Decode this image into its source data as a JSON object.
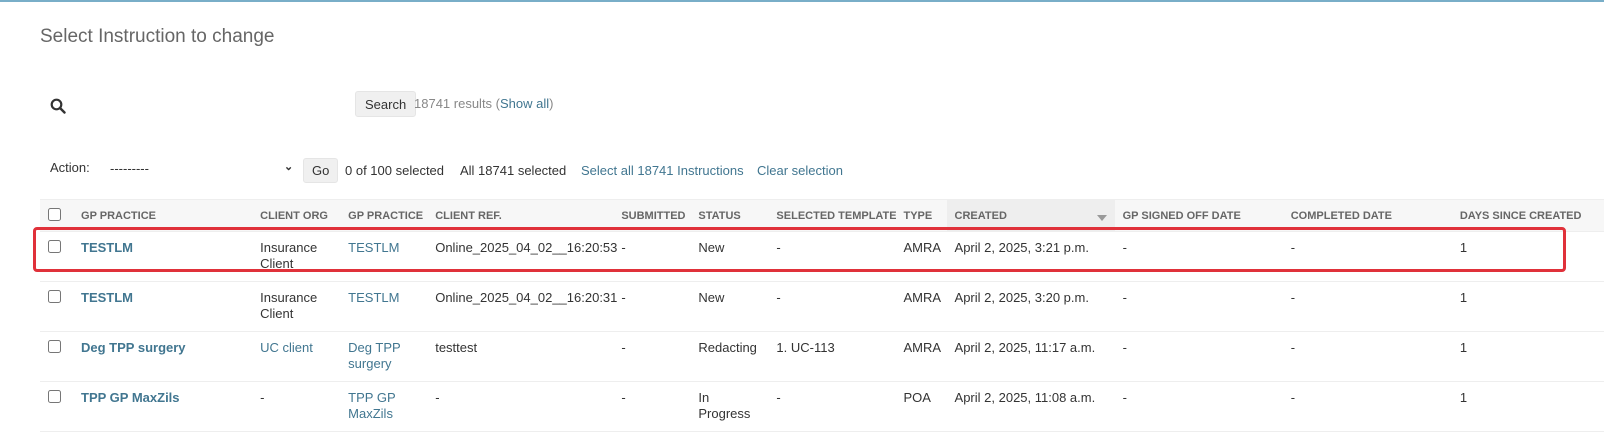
{
  "page": {
    "title": "Select Instruction to change"
  },
  "search": {
    "placeholder": "",
    "button_label": "Search",
    "results_text": "18741 results (",
    "show_all_label": "Show all",
    "results_close": ")"
  },
  "actions": {
    "label": "Action:",
    "selected_option": "---------",
    "go_label": "Go",
    "counter": "0 of 100 selected",
    "all_selected": "All 18741 selected",
    "select_all_link": "Select all 18741 Instructions",
    "clear_selection_link": "Clear selection"
  },
  "table": {
    "columns": [
      "GP PRACTICE",
      "CLIENT ORG",
      "GP PRACTICE",
      "CLIENT REF.",
      "SUBMITTED",
      "STATUS",
      "SELECTED TEMPLATE",
      "TYPE",
      "CREATED",
      "GP SIGNED OFF DATE",
      "COMPLETED DATE",
      "DAYS SINCE CREATED"
    ],
    "sorted_column": "CREATED",
    "rows": [
      {
        "gp_practice": "TESTLM",
        "client_org": "Insurance Client",
        "gp_practice_2": "TESTLM",
        "client_ref": "Online_2025_04_02__16:20:53",
        "submitted": "-",
        "status": "New",
        "template": "-",
        "type": "AMRA",
        "created": "April 2, 2025, 3:21 p.m.",
        "gp_signed_off": "-",
        "completed": "-",
        "days": "1"
      },
      {
        "gp_practice": "TESTLM",
        "client_org": "Insurance Client",
        "gp_practice_2": "TESTLM",
        "client_ref": "Online_2025_04_02__16:20:31",
        "submitted": "-",
        "status": "New",
        "template": "-",
        "type": "AMRA",
        "created": "April 2, 2025, 3:20 p.m.",
        "gp_signed_off": "-",
        "completed": "-",
        "days": "1"
      },
      {
        "gp_practice": "Deg TPP surgery",
        "client_org": "UC client",
        "gp_practice_2": "Deg TPP surgery",
        "client_ref": "testtest",
        "submitted": "-",
        "status": "Redacting",
        "template": "1. UC-113",
        "type": "AMRA",
        "created": "April 2, 2025, 11:17 a.m.",
        "gp_signed_off": "-",
        "completed": "-",
        "days": "1"
      },
      {
        "gp_practice": "TPP GP MaxZils",
        "client_org": "-",
        "gp_practice_2": "TPP GP MaxZils",
        "client_ref": "-",
        "submitted": "-",
        "status": "In Progress",
        "template": "-",
        "type": "POA",
        "created": "April 2, 2025, 11:08 a.m.",
        "gp_signed_off": "-",
        "completed": "-",
        "days": "1"
      }
    ]
  },
  "colors": {
    "link": "#417690",
    "highlight": "#e0313a",
    "topbar": "#79aec8"
  }
}
